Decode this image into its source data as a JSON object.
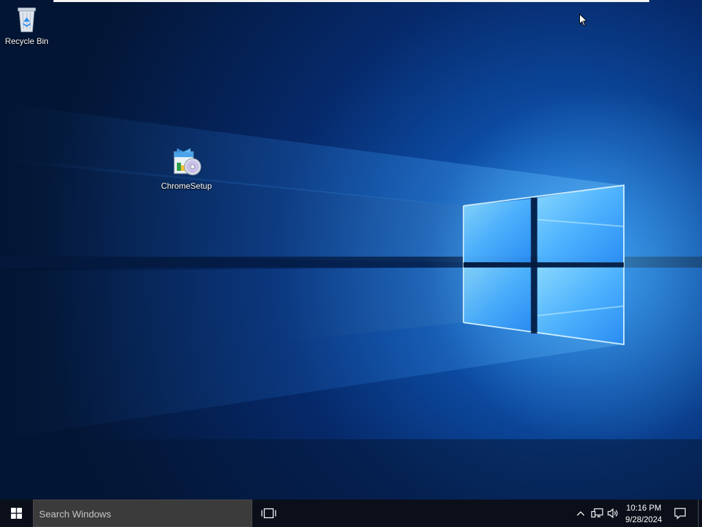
{
  "desktop": {
    "icons": [
      {
        "label": "Recycle Bin",
        "icon": "recycle-bin-icon"
      },
      {
        "label": "ChromeSetup",
        "icon": "installer-disc-icon"
      }
    ]
  },
  "taskbar": {
    "start_icon": "windows-logo-icon",
    "search_placeholder": "Search Windows",
    "task_view_icon": "task-view-icon",
    "tray": {
      "chevron_icon": "chevron-up-icon",
      "network_icon": "network-icon",
      "volume_icon": "volume-icon"
    },
    "clock": {
      "time": "10:16 PM",
      "date": "9/28/2024"
    },
    "action_center_icon": "notification-icon"
  },
  "colors": {
    "wallpaper_dark": "#041a3e",
    "wallpaper_glow": "#1e8cff",
    "taskbar_bg": "#0a0f1a",
    "search_bg": "#3b3b3b"
  }
}
